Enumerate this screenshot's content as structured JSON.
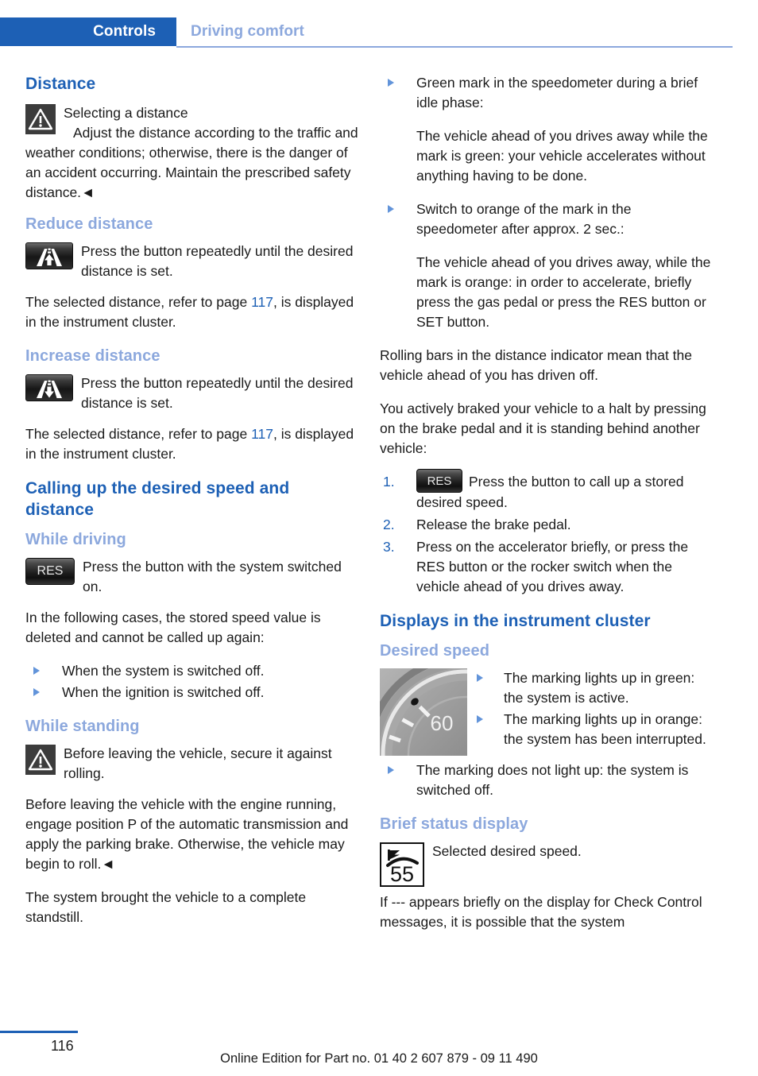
{
  "header": {
    "tab_label": "Controls",
    "section_label": "Driving comfort"
  },
  "left_column": {
    "heading_distance": "Distance",
    "warning_title": "Selecting a distance",
    "warning_body": "Adjust the distance according to the traffic and weather conditions; otherwise, there is the danger of an accident occurring. Maintain the prescribed safety distance.◄",
    "heading_reduce": "Reduce distance",
    "reduce_instruction": "Press the button repeatedly until the desired distance is set.",
    "reduce_note_pre": "The selected distance, refer to page ",
    "reduce_note_page": "117",
    "reduce_note_post": ", is displayed in the instrument cluster.",
    "heading_increase": "Increase distance",
    "increase_instruction": "Press the button repeatedly until the desired distance is set.",
    "increase_note_pre": "The selected distance, refer to page ",
    "increase_note_page": "117",
    "increase_note_post": ", is displayed in the instrument cluster.",
    "heading_calling_up": "Calling up the desired speed and distance",
    "heading_while_driving": "While driving",
    "res_button_label": "RES",
    "while_driving_instruction": "Press the button with the system switched on.",
    "deleted_intro": "In the following cases, the stored speed value is deleted and cannot be called up again:",
    "deleted_bullets": [
      "When the system is switched off.",
      "When the ignition is switched off."
    ],
    "heading_while_standing": "While standing",
    "standing_warning": "Before leaving the vehicle, secure it against rolling.",
    "standing_body": "Before leaving the vehicle with the engine running, engage position P of the automatic transmission and apply the parking brake. Otherwise, the vehicle may begin to roll.◄",
    "standstill_note": "The system brought the vehicle to a complete standstill."
  },
  "right_column": {
    "bullet_green_title": "Green mark in the speedometer during a brief idle phase:",
    "bullet_green_body": "The vehicle ahead of you drives away while the mark is green: your vehicle accelerates without anything having to be done.",
    "bullet_orange_title": "Switch to orange of the mark in the speedometer after approx. 2 sec.:",
    "bullet_orange_body": "The vehicle ahead of you drives away, while the mark is orange: in order to accelerate, briefly press the gas pedal or press the RES button or SET button.",
    "rolling_bars_note": "Rolling bars in the distance indicator mean that the vehicle ahead of you has driven off.",
    "braked_intro": "You actively braked your vehicle to a halt by pressing on the brake pedal and it is standing behind another vehicle:",
    "steps": [
      {
        "number": "1.",
        "has_res_icon": true,
        "res_label": "RES",
        "text": "Press the button to call up a stored desired speed."
      },
      {
        "number": "2.",
        "has_res_icon": false,
        "res_label": "",
        "text": "Release the brake pedal."
      },
      {
        "number": "3.",
        "has_res_icon": false,
        "res_label": "",
        "text": "Press on the accelerator briefly, or press the RES button or the rocker switch when the vehicle ahead of you drives away."
      }
    ],
    "heading_displays": "Displays in the instrument cluster",
    "heading_desired_speed": "Desired speed",
    "speedometer_value": "60",
    "speed_bullets": [
      "The marking lights up in green: the system is active.",
      "The marking lights up in orange: the system has been interrupted."
    ],
    "speed_bullet_off": "The marking does not light up: the system is switched off.",
    "heading_brief_status": "Brief status display",
    "status_icon_value": "55",
    "status_icon_caption": "Selected desired speed.",
    "check_control_note": "If --- appears briefly on the display for Check Control messages, it is possible that the system"
  },
  "footer": {
    "page_number": "116",
    "edition_note": "Online Edition for Part no. 01 40 2 607 879 - 09 11 490"
  },
  "colors": {
    "accent_blue": "#1d60b5",
    "light_blue": "#8ca8dd",
    "text": "#1a1a1a"
  }
}
